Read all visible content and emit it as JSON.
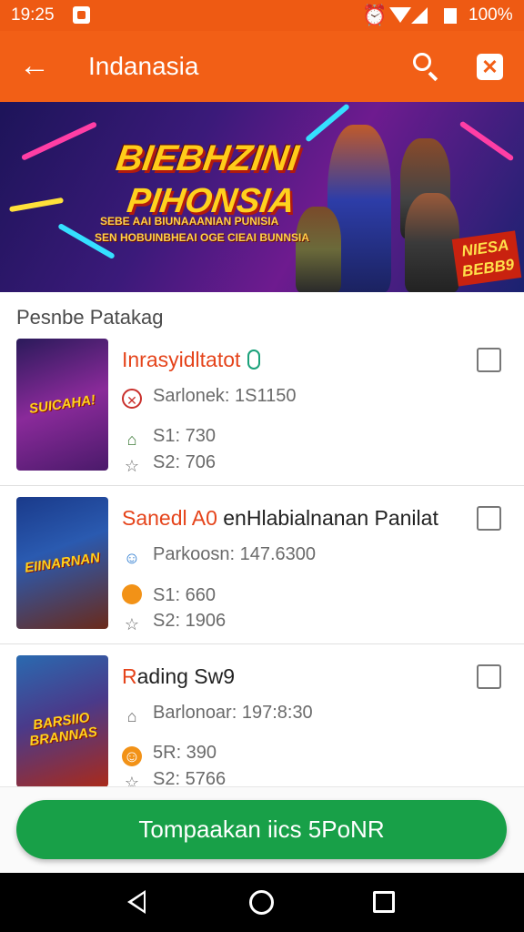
{
  "status_bar": {
    "time": "19:25",
    "battery": "100%",
    "icons": [
      "sim-icon",
      "alarm-icon",
      "wifi-icon",
      "signal-icon",
      "battery-icon"
    ]
  },
  "app_bar": {
    "title": "Indanasia",
    "icons": [
      "back-arrow-icon",
      "search-icon",
      "close-icon"
    ]
  },
  "banner": {
    "title_line1": "BIEBHZINI",
    "title_line2": "PIHONSIA",
    "subtitle_line1": "SEBE AAI BIUNAAANIAN PUNISIA",
    "subtitle_line2": "SEN HOBUINBHEAI OGE CIEAI BUNNSIA",
    "badge_line1": "NIESA",
    "badge_line2": "BEBB9"
  },
  "section": {
    "title": "Pesnbe Patakag"
  },
  "items": [
    {
      "thumb_text": "SUICAHA!",
      "title_accent": "Inrasyidltatot",
      "title_rest": "",
      "meta1_icon": "no-entry-icon",
      "meta1": "Sarlonek: 1S1150",
      "meta2_icon": "house-icon",
      "meta2": "S1: 730",
      "meta3_icon": "star-icon",
      "meta3": "S2: 706",
      "checked": false
    },
    {
      "thumb_text": "EIINARNAN",
      "title_accent": "Sanedl A0",
      "title_rest": "enHlabialnanan Panilat",
      "meta1_icon": "badge-icon",
      "meta1": "Parkoosn: 147.6300",
      "meta2_icon": "orange-circle-icon",
      "meta2": "S1: 660",
      "meta3_icon": "star-icon",
      "meta3": "S2: 1906",
      "checked": false
    },
    {
      "thumb_text": "BARSIIO BRANNAS",
      "title_accent": "R",
      "title_rest": "ading Sw9",
      "meta1_icon": "house-icon",
      "meta1": "Barlonoar: 197:8:30",
      "meta2_icon": "orange-face-icon",
      "meta2": "5R: 390",
      "meta3_icon": "star-icon",
      "meta3": "S2: 5766",
      "checked": false
    }
  ],
  "cta": {
    "label": "Tompaakan iics 5PoNR"
  },
  "nav_bar": {
    "icons": [
      "nav-back-icon",
      "nav-home-icon",
      "nav-recents-icon"
    ]
  },
  "colors": {
    "app_bar": "#f25f16",
    "status_bar": "#ee5a13",
    "cta": "#18a048",
    "title_accent": "#e5441b"
  }
}
